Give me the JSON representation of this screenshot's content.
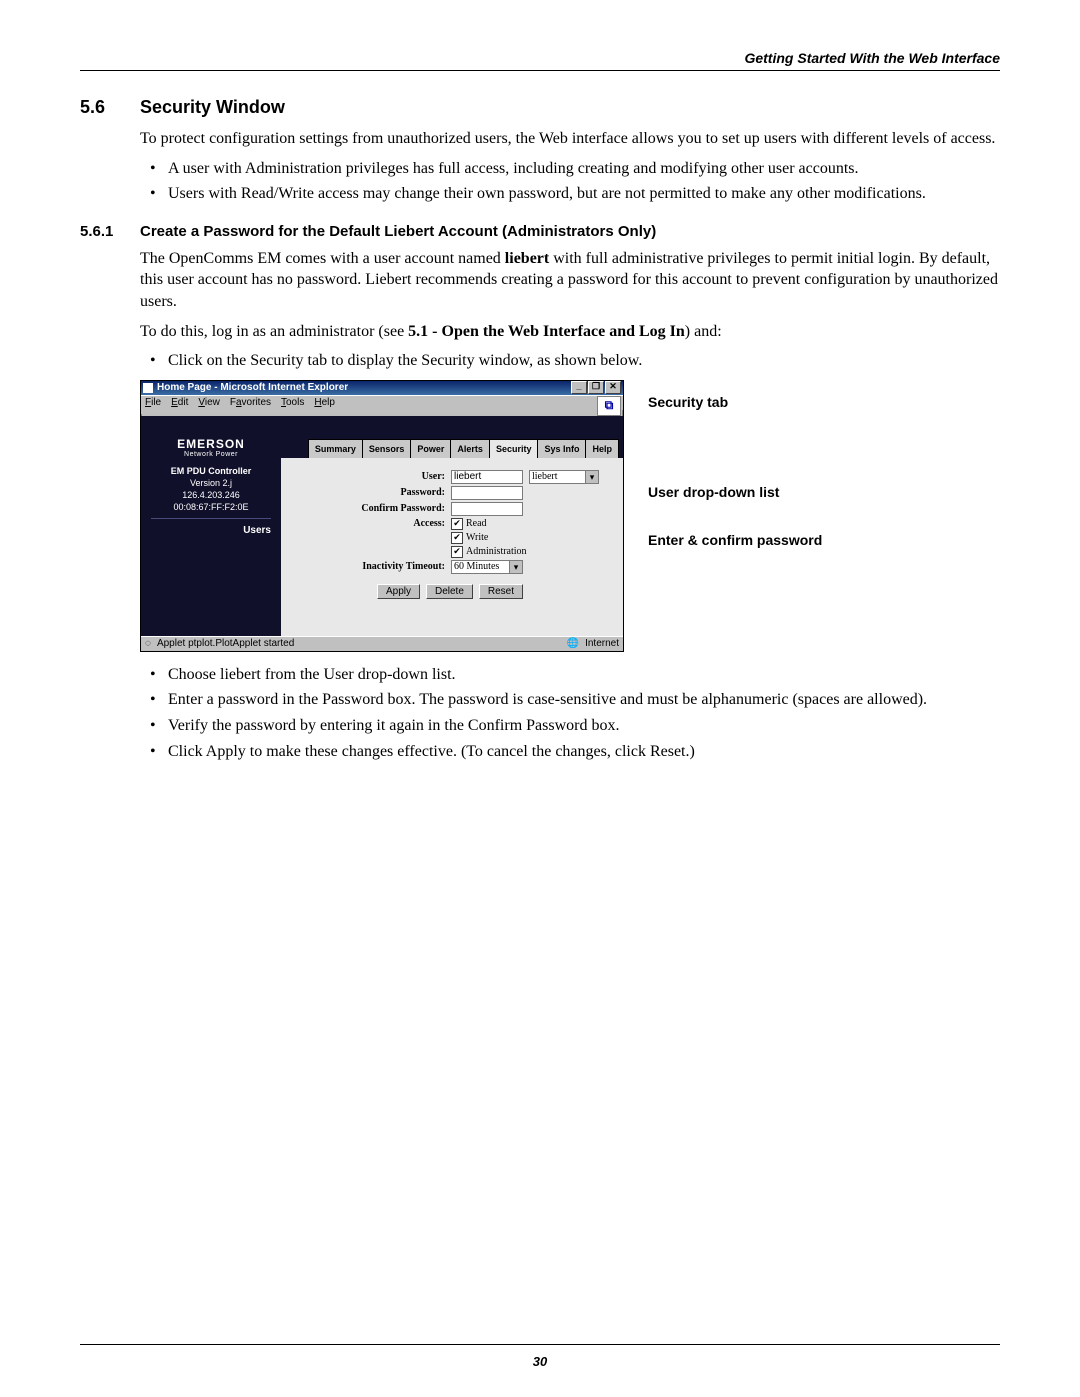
{
  "running_head": "Getting Started With the Web Interface",
  "page_number": "30",
  "section": {
    "num": "5.6",
    "title": "Security Window"
  },
  "subsection": {
    "num": "5.6.1",
    "title": "Create a Password for the Default Liebert Account (Administrators Only)"
  },
  "intro": "To protect configuration settings from unauthorized users, the Web interface allows you to set up users with different levels of access.",
  "intro_bullets": {
    "b1_a": "A user with ",
    "b1_bold": "Administration",
    "b1_b": " privileges has full access, including creating and modifying other user accounts.",
    "b2_a": "Users with ",
    "b2_bold": "Read/Write access",
    "b2_b": " may change their own password, but are not permitted to make any other modifications."
  },
  "sub_p1_a": "The OpenComms EM comes with a user account named ",
  "sub_p1_bold": "liebert",
  "sub_p1_b": " with full administrative privileges to permit initial login. By default, this user account has no password. Liebert recommends creating a password for this account to prevent configuration by unauthorized users.",
  "sub_p2_a": "To do this, log in as an administrator (see ",
  "sub_p2_bold": "5.1 - Open the Web Interface and Log In",
  "sub_p2_b": ") and:",
  "pre_fig_bullet_a": "Click on the ",
  "pre_fig_bullet_bold": "Security",
  "pre_fig_bullet_b": " tab to display the Security window, as shown below.",
  "post_bullets": {
    "b1_a": "Choose ",
    "b1_bold": "liebert",
    "b1_b": " from the User drop-down list.",
    "b2": "Enter a password in the Password box. The password is case-sensitive and must be alphanumeric (spaces are allowed).",
    "b3": "Verify the password by entering it again in the Confirm Password box.",
    "b4_a": "Click ",
    "b4_bold1": "Apply",
    "b4_b": " to make these changes effective. (To cancel the changes, click ",
    "b4_bold2": "Reset",
    "b4_c": ".)"
  },
  "annotations": {
    "security_tab": "Security tab",
    "user_dropdown": "User drop-down list",
    "enter_confirm": "Enter & confirm password"
  },
  "ie": {
    "title": "Home Page - Microsoft Internet Explorer",
    "menu": {
      "file": "File",
      "edit": "Edit",
      "view": "View",
      "favorites": "Favorites",
      "tools": "Tools",
      "help": "Help"
    },
    "winbtns": {
      "min": "_",
      "max": "❐",
      "close": "✕"
    },
    "brand": {
      "name": "EMERSON",
      "sub": "Network Power"
    },
    "tabs": [
      "Summary",
      "Sensors",
      "Power",
      "Alerts",
      "Security",
      "Sys Info",
      "Help"
    ],
    "active_tab": "Security",
    "side": {
      "line1": "EM PDU Controller",
      "line2": "Version 2.j",
      "line3": "126.4.203.246",
      "line4": "00:08:67:FF:F2:0E",
      "users": "Users"
    },
    "form": {
      "user_label": "User:",
      "user_value": "liebert",
      "user_select": "liebert",
      "password_label": "Password:",
      "confirm_label": "Confirm Password:",
      "access_label": "Access:",
      "access_read": "Read",
      "access_write": "Write",
      "access_admin": "Administration",
      "timeout_label": "Inactivity Timeout:",
      "timeout_value": "60 Minutes",
      "apply": "Apply",
      "delete": "Delete",
      "reset": "Reset"
    },
    "status": {
      "left": "Applet ptplot.PlotApplet started",
      "right": "Internet"
    }
  }
}
